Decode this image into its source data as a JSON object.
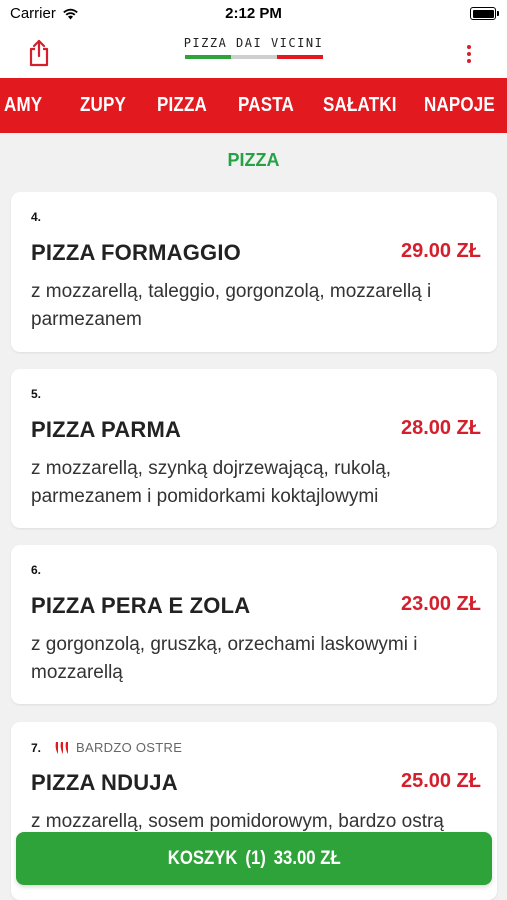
{
  "status_bar": {
    "carrier": "Carrier",
    "time": "2:12 PM"
  },
  "header": {
    "logo_text": "PIZZA DAI VICINI",
    "flag_colors": [
      "#2ea33a",
      "#cfcfcf",
      "#e2191f"
    ]
  },
  "categories": [
    "AMY",
    "ZUPY",
    "PIZZA",
    "PASTA",
    "SAŁATKI",
    "NAPOJE"
  ],
  "section_title": "PIZZA",
  "items": [
    {
      "number": "4.",
      "name": "PIZZA FORMAGGIO",
      "price": "29.00 ZŁ",
      "description": "z mozzarellą, taleggio, gorgonzolą, mozzarellą i parmezanem"
    },
    {
      "number": "5.",
      "name": "PIZZA PARMA",
      "price": "28.00 ZŁ",
      "description": "z mozzarellą, szynką dojrzewającą, rukolą, parmezanem i pomidorkami koktajlowymi"
    },
    {
      "number": "6.",
      "name": "PIZZA PERA E ZOLA",
      "price": "23.00 ZŁ",
      "description": "z gorgonzolą, gruszką, orzechami laskowymi i mozzarellą"
    },
    {
      "number": "7.",
      "badge": "BARDZO OSTRE",
      "name": "PIZZA NDUJA",
      "price": "25.00 ZŁ",
      "description": "z mozzarellą, sosem pomidorowym, bardzo ostrą"
    }
  ],
  "cart": {
    "label": "KOSZYK",
    "count": "(1)",
    "total": "33.00 ZŁ"
  },
  "colors": {
    "accent_red": "#e2191f",
    "price_red": "#d4202c",
    "green": "#2ea33a",
    "section_green": "#25a244"
  }
}
